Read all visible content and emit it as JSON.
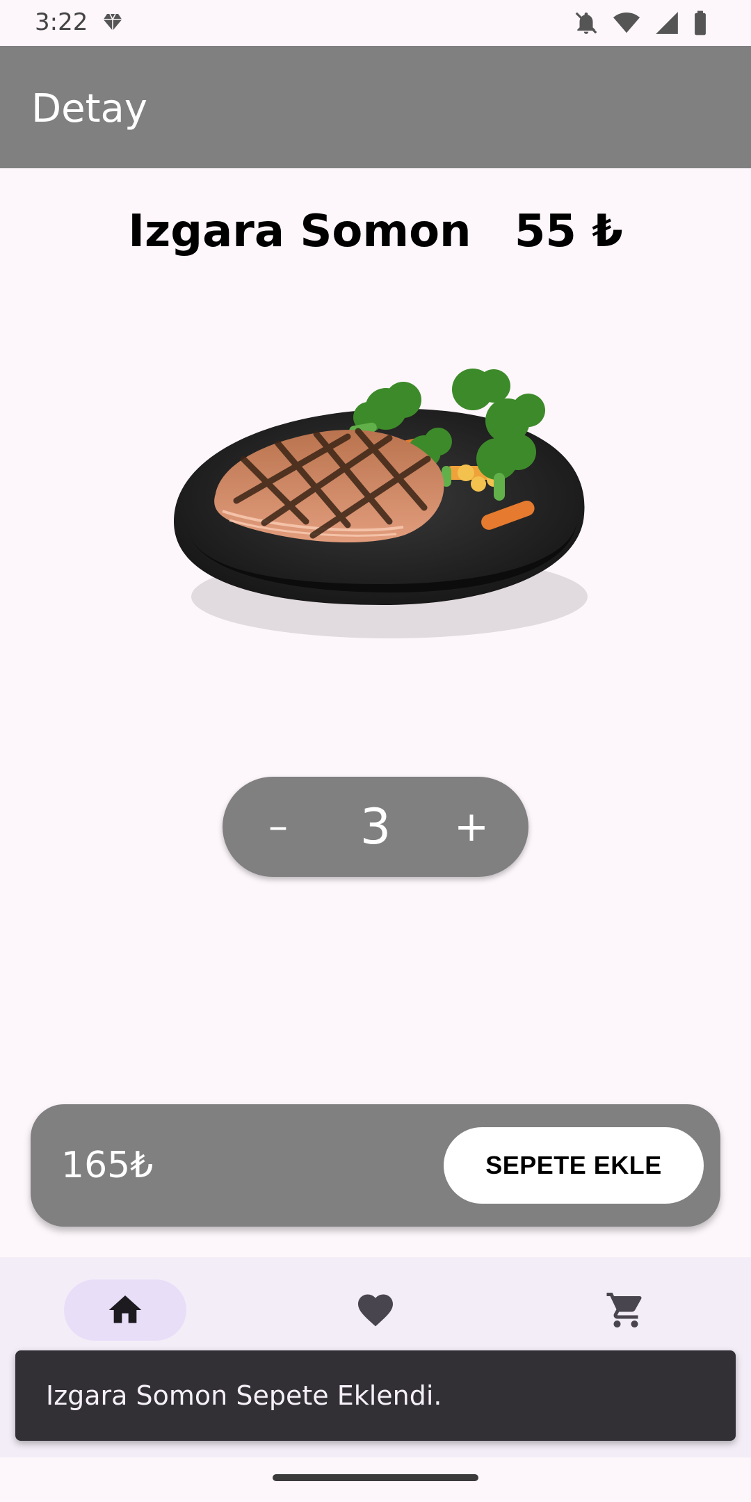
{
  "status_bar": {
    "time": "3:22",
    "icons": [
      "gem-icon",
      "bell-off-icon",
      "wifi-icon",
      "signal-icon",
      "battery-icon"
    ]
  },
  "app_bar": {
    "title": "Detay"
  },
  "product": {
    "name": "Izgara Somon",
    "price": "55 ₺",
    "image_alt": "grilled-salmon-plate"
  },
  "stepper": {
    "minus_label": "–",
    "quantity": "3",
    "plus_label": "+"
  },
  "cart_bar": {
    "total": "165₺",
    "add_button_label": "SEPETE EKLE"
  },
  "nav": {
    "items": [
      {
        "icon": "home-icon",
        "selected": true
      },
      {
        "icon": "heart-icon",
        "selected": false
      },
      {
        "icon": "cart-icon",
        "selected": false
      }
    ]
  },
  "snackbar": {
    "message": "Izgara Somon Sepete Eklendi."
  },
  "colors": {
    "background": "#fdf7fb",
    "app_bar": "#808080",
    "nav_bar": "#f3edf7",
    "nav_selected": "#e8def8",
    "snackbar": "#322f35"
  }
}
